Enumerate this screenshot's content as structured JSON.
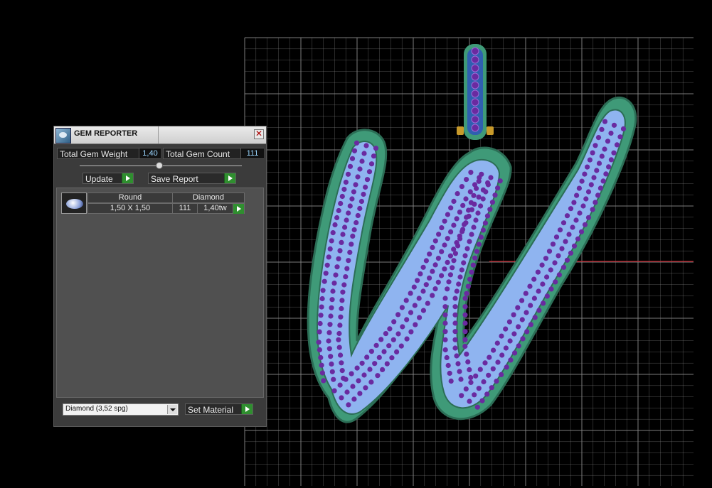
{
  "panel": {
    "title": "GEM REPORTER",
    "close_glyph": "✕",
    "icons": {
      "app": "gem-reporter-icon",
      "close": "close-icon",
      "go": "play-arrow-icon"
    },
    "total_weight": {
      "label": "Total Gem Weight",
      "value": "1,40"
    },
    "total_count": {
      "label": "Total Gem Count",
      "value": "111"
    },
    "update_label": "Update",
    "save_report_label": "Save Report",
    "gem_row": {
      "shape": "Round",
      "size": "1,50 X 1,50",
      "material": "Diamond",
      "count": "111",
      "weight": "1,40tw"
    },
    "material_select": {
      "selected": "Diamond     (3,52 spg)"
    },
    "set_material_label": "Set Material"
  },
  "viewport": {
    "background": "#000000",
    "grid_color": "#8a8a8a",
    "axis_color": "#c0202a",
    "setting_color": "#3f9a78",
    "stone_color": "#8fb4f0",
    "prong_color": "#6a2aa0",
    "bail_color": "#2f5fb0"
  }
}
